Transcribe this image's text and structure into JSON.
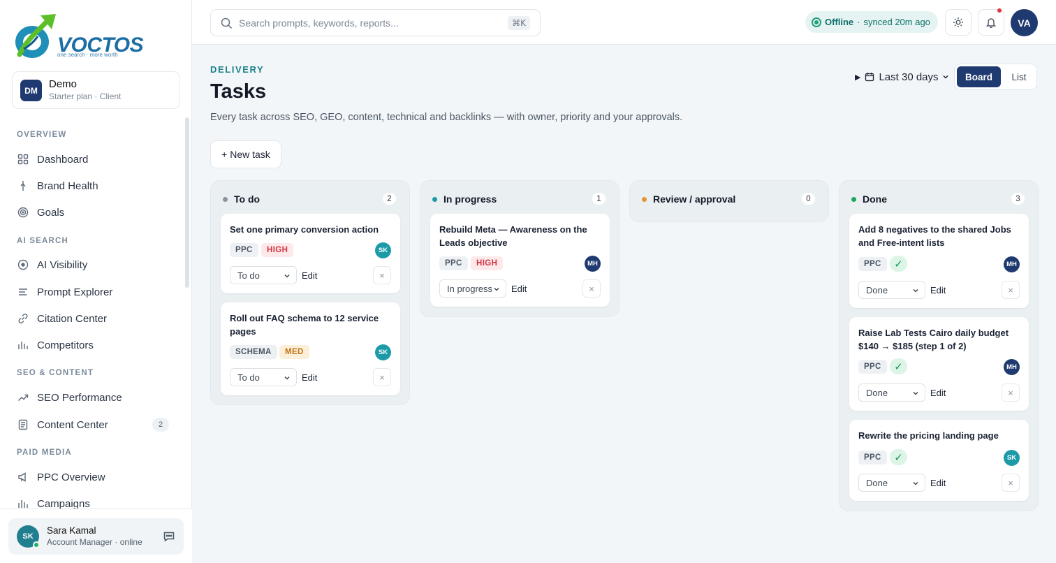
{
  "brand": {
    "name": "VOCTOS",
    "tagline": "one search · more worth"
  },
  "org": {
    "initials": "DM",
    "name": "Demo",
    "plan": "Starter plan · Client"
  },
  "sidebar": {
    "sections": [
      {
        "label": "OVERVIEW"
      },
      {
        "label": "AI SEARCH"
      },
      {
        "label": "SEO & CONTENT"
      },
      {
        "label": "PAID MEDIA"
      }
    ],
    "items": [
      {
        "label": "Dashboard",
        "icon": "grid-icon"
      },
      {
        "label": "Brand Health",
        "icon": "pulse-icon"
      },
      {
        "label": "Goals",
        "icon": "target-icon"
      },
      {
        "label": "AI Visibility",
        "icon": "eye-icon"
      },
      {
        "label": "Prompt Explorer",
        "icon": "list-icon"
      },
      {
        "label": "Citation Center",
        "icon": "link-icon"
      },
      {
        "label": "Competitors",
        "icon": "bars-icon"
      },
      {
        "label": "SEO Performance",
        "icon": "trend-icon"
      },
      {
        "label": "Content Center",
        "icon": "document-icon",
        "badge": "2"
      },
      {
        "label": "PPC Overview",
        "icon": "megaphone-icon"
      },
      {
        "label": "Campaigns",
        "icon": "bars-icon"
      }
    ]
  },
  "user": {
    "initials": "SK",
    "name": "Sara Kamal",
    "role": "Account Manager · online"
  },
  "topbar": {
    "search_placeholder": "Search prompts, keywords, reports...",
    "shortcut": "⌘K",
    "status_label": "Offline",
    "status_sep": "·",
    "status_sync": "synced 20m ago",
    "avatar_initials": "VA"
  },
  "page": {
    "eyebrow": "DELIVERY",
    "title": "Tasks",
    "description": "Every task across SEO, GEO, content, technical and backlinks — with owner, priority and your approvals.",
    "range_label": "Last 30 days",
    "view_board": "Board",
    "view_list": "List",
    "new_task": "+ New task",
    "edit_label": "Edit",
    "delete_glyph": "×"
  },
  "colors": {
    "todo": "#8a939e",
    "in_progress": "#1c9aa8",
    "review": "#e3952f",
    "done": "#1fa65a",
    "brand": "#1e3a70"
  },
  "columns": [
    {
      "title": "To do",
      "count": "2",
      "cards": [
        {
          "title": "Set one primary conversion action",
          "tag": "PPC",
          "priority": "HIGH",
          "owner": "SK",
          "status": "To do"
        },
        {
          "title": "Roll out FAQ schema to 12 service pages",
          "tag": "SCHEMA",
          "priority": "MED",
          "owner": "SK",
          "status": "To do"
        }
      ]
    },
    {
      "title": "In progress",
      "count": "1",
      "cards": [
        {
          "title": "Rebuild Meta — Awareness on the Leads objective",
          "tag": "PPC",
          "priority": "HIGH",
          "owner": "MH",
          "status": "In progress"
        }
      ]
    },
    {
      "title": "Review / approval",
      "count": "0",
      "cards": []
    },
    {
      "title": "Done",
      "count": "3",
      "cards": [
        {
          "title": "Add 8 negatives to the shared Jobs and Free-intent lists",
          "tag": "PPC",
          "check": "✓",
          "owner": "MH",
          "status": "Done"
        },
        {
          "title": "Raise Lab Tests Cairo daily budget $140 → $185 (step 1 of 2)",
          "tag": "PPC",
          "check": "✓",
          "owner": "MH",
          "status": "Done"
        },
        {
          "title": "Rewrite the pricing landing page",
          "tag": "PPC",
          "check": "✓",
          "owner": "SK",
          "status": "Done"
        }
      ]
    }
  ]
}
